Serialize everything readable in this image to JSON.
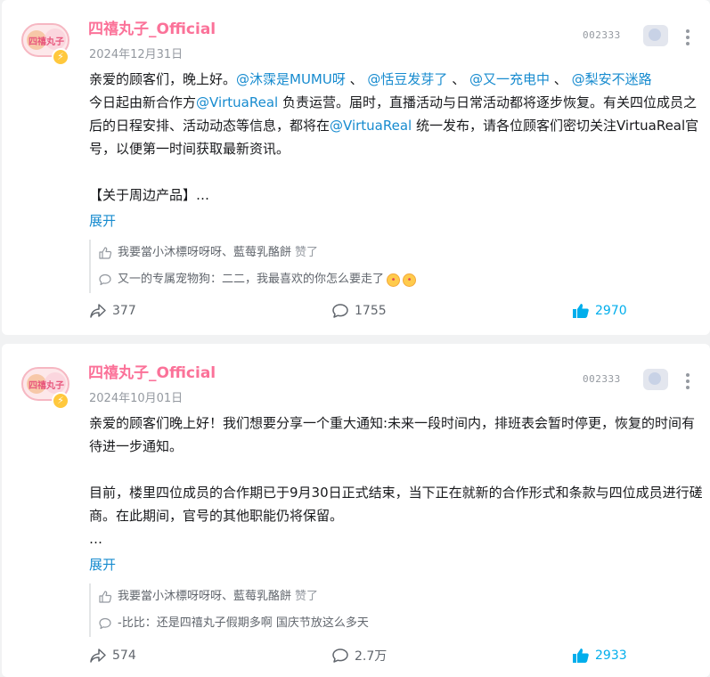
{
  "colors": {
    "accent": "#00aeec",
    "author": "#fb7299",
    "mention": "#178bcf",
    "muted": "#9499a0",
    "text": "#18191c"
  },
  "posts": [
    {
      "author": "四禧丸子_Official",
      "date": "2024年12月31日",
      "decor_number": "002333",
      "avatar_text": "四禧丸子",
      "badge_icon": "lightning-icon",
      "more_icon": "more-vertical-icon",
      "content": {
        "l1_text": "亲爱的顾客们，晚上好。",
        "l1_m1": "@沐霂是MUMU呀",
        "l1_s1": " 、",
        "l1_m2": "@恬豆发芽了",
        "l1_s2": " 、",
        "l1_m3": "@又一充电中",
        "l1_s3": " 、",
        "l1_m4": "@梨安不迷路",
        "l2_a": "今日起由新合作方",
        "l2_m": "@VirtuaReal",
        "l2_b": " 负责运营。届时，直播活动与日常活动都将逐步恢复。有关四位成员之后的日程安排、活动动态等信息，都将在",
        "l2_m2": "@VirtuaReal",
        "l2_c": " 统一发布，请各位顾客们密切关注VirtuaReal官号，以便第一时间获取最新资讯。",
        "l4": "【关于周边产品】…"
      },
      "expand_label": "展开",
      "likes_line": {
        "icon": "thumb-up-outline-icon",
        "names": "我要當小沐標呀呀呀、藍莓乳酪餅",
        "suffix": "赞了"
      },
      "comment_line": {
        "icon": "comment-outline-icon",
        "text": "又一的专属宠物狗：二二，我最喜欢的你怎么要走了",
        "emoji": [
          "crying-face-emoji",
          "crying-face-emoji"
        ]
      },
      "actions": {
        "share": {
          "icon": "share-icon",
          "count": "377"
        },
        "comment": {
          "icon": "comment-icon",
          "count": "1755"
        },
        "like": {
          "icon": "thumb-up-filled-icon",
          "count": "2970"
        }
      }
    },
    {
      "author": "四禧丸子_Official",
      "date": "2024年10月01日",
      "decor_number": "002333",
      "avatar_text": "四禧丸子",
      "badge_icon": "lightning-icon",
      "more_icon": "more-vertical-icon",
      "content": {
        "p1": "亲爱的顾客们晚上好！我们想要分享一个重大通知:未来一段时间内，排班表会暂时停更，恢复的时间有待进一步通知。",
        "p2": "目前，楼里四位成员的合作期已于9月30日正式结束，当下正在就新的合作形式和条款与四位成员进行磋商。在此期间，官号的其他职能仍将保留。",
        "p3": "…"
      },
      "expand_label": "展开",
      "likes_line": {
        "icon": "thumb-up-outline-icon",
        "names": "我要當小沐標呀呀呀、藍莓乳酪餅",
        "suffix": "赞了"
      },
      "comment_line": {
        "icon": "comment-outline-icon",
        "text": "-比比：还是四禧丸子假期多啊 国庆节放这么多天"
      },
      "actions": {
        "share": {
          "icon": "share-icon",
          "count": "574"
        },
        "comment": {
          "icon": "comment-icon",
          "count": "2.7万"
        },
        "like": {
          "icon": "thumb-up-filled-icon",
          "count": "2933"
        }
      }
    }
  ]
}
